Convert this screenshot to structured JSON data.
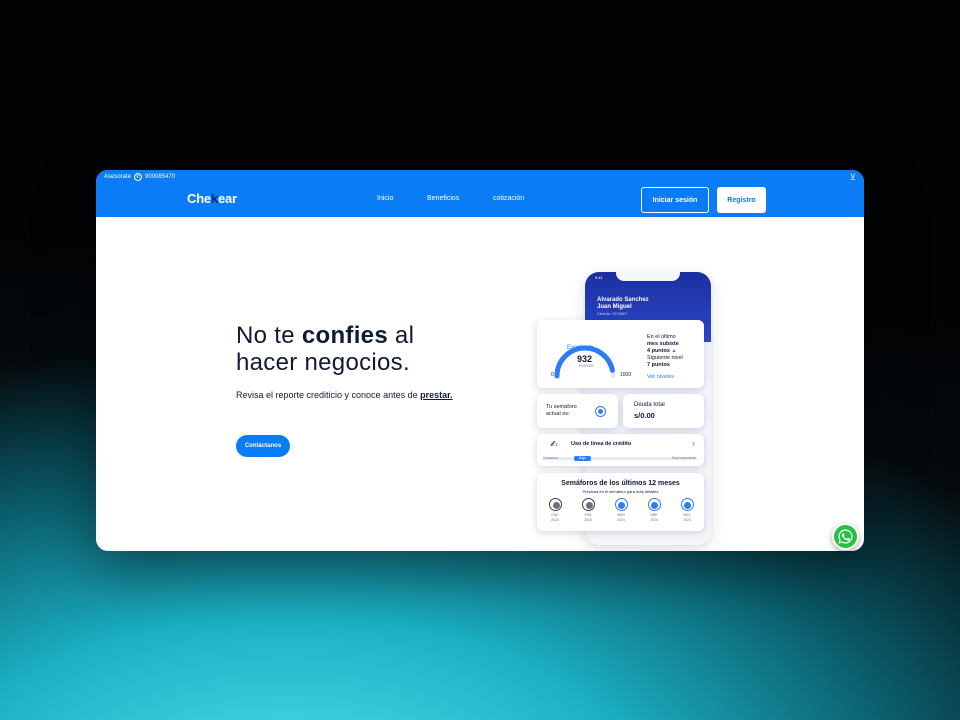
{
  "topbar": {
    "contact_label": "Asesorate",
    "phone": "900085470"
  },
  "nav": {
    "logo_prefix": "Che",
    "logo_k": "k",
    "logo_suffix": "ear",
    "items": [
      {
        "label": "Inicio"
      },
      {
        "label": "Beneficios"
      },
      {
        "label": "cotización"
      }
    ],
    "login_label": "Iniciar sesión",
    "register_label": "Registro"
  },
  "hero": {
    "line1_a": "No te ",
    "line1_b": "confies",
    "line1_c": " al",
    "line2": "hacer negocios.",
    "subtitle": "Revisa el reporte crediticio y conoce antes de ",
    "subtitle_em": "prestar.",
    "cta_label": "Contáctanos"
  },
  "phone": {
    "time": "9:41",
    "name_line1": "Alvarado Sanchez",
    "name_line2": "Juan Miguel",
    "dni": "Cédula: 1234567",
    "score": {
      "label": "Excelente",
      "value": "932",
      "unit": "PUNTOS",
      "min": "0",
      "max": "1000",
      "info_line1": "En el último",
      "info_line2": "mes subiste",
      "info_line3": "4 puntos",
      "info_line4": "Siguiente nivel",
      "info_line5": "7 puntos",
      "link": "Ver niveles",
      "fill_fraction": 0.932
    },
    "semaforo": {
      "line1": "Tu semáforo",
      "line2": "actual es:",
      "color": "#2b7cf5"
    },
    "deuda": {
      "label": "Deuda total",
      "value": "s/0.00"
    },
    "linea": {
      "title": "Uso de línea de crédito",
      "left_label": "Consumo",
      "chip_label": "Bajo",
      "right_label": "Muy importante"
    },
    "semaforos": {
      "title": "Semáforos de los últimos 12 meses",
      "subtitle": "Presiona en el semáforo para más detalles",
      "months": [
        {
          "label": "ENE",
          "year": "2024",
          "status": "gray"
        },
        {
          "label": "FEB",
          "year": "2024",
          "status": "gray"
        },
        {
          "label": "MAR",
          "year": "2024",
          "status": "blue"
        },
        {
          "label": "ABR",
          "year": "2024",
          "status": "blue"
        },
        {
          "label": "MAY",
          "year": "2024",
          "status": "blue"
        }
      ]
    }
  },
  "colors": {
    "brand": "#0a7cf5",
    "dark": "#111a33",
    "whatsapp": "#26c043"
  },
  "icons": {
    "phone": "phone-icon",
    "toggle": "toggle-icon",
    "hand": "hand-card-icon",
    "chevron": "chevron-right-icon",
    "whatsapp": "whatsapp-icon"
  }
}
